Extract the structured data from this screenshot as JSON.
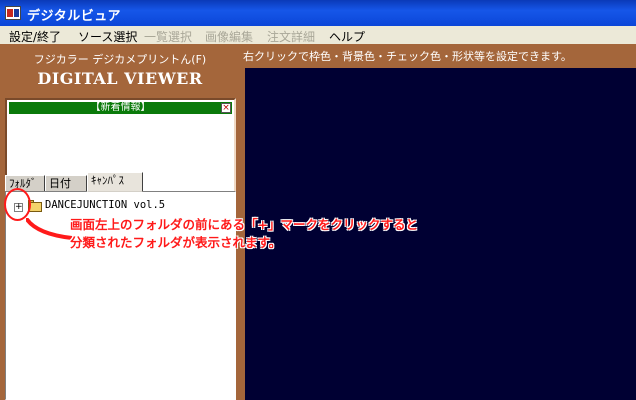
{
  "window": {
    "title": "デジタルビュア",
    "icon": "app-icon"
  },
  "menu": {
    "items": [
      {
        "label": "設定/終了",
        "enabled": true
      },
      {
        "label": "ソース選択",
        "enabled": true
      },
      {
        "label": "一覧選択",
        "enabled": false
      },
      {
        "label": "画像編集",
        "enabled": false
      },
      {
        "label": "注文詳細",
        "enabled": false
      },
      {
        "label": "ヘルプ",
        "enabled": true
      }
    ]
  },
  "brand": {
    "subtitle": "フジカラー デジカメプリントん(F)",
    "title": "DIGITAL VIEWER",
    "panel_color": "#a4663b"
  },
  "news": {
    "title": "【新着情報】",
    "close_glyph": "×",
    "header_color": "#0a7a0a"
  },
  "tabs": [
    {
      "label": "ﾌｫﾙﾀﾞ",
      "active": false
    },
    {
      "label": "日付",
      "active": false
    },
    {
      "label": "ｷｬﾝﾊﾟｽ",
      "active": true
    }
  ],
  "tree": {
    "expander": "+",
    "items": [
      {
        "label": "DANCEJUNCTION vol.5",
        "icon": "folder-icon"
      }
    ]
  },
  "hint": "右クリックで枠色・背景色・チェック色・形状等を設定できます。",
  "canvas_color": "#000033",
  "annotation": {
    "line1": "画面左上のフォルダの前にある「+」マークをクリックすると",
    "line2": "分類されたフォルダが表示されます。",
    "color": "#ff1a1a"
  }
}
